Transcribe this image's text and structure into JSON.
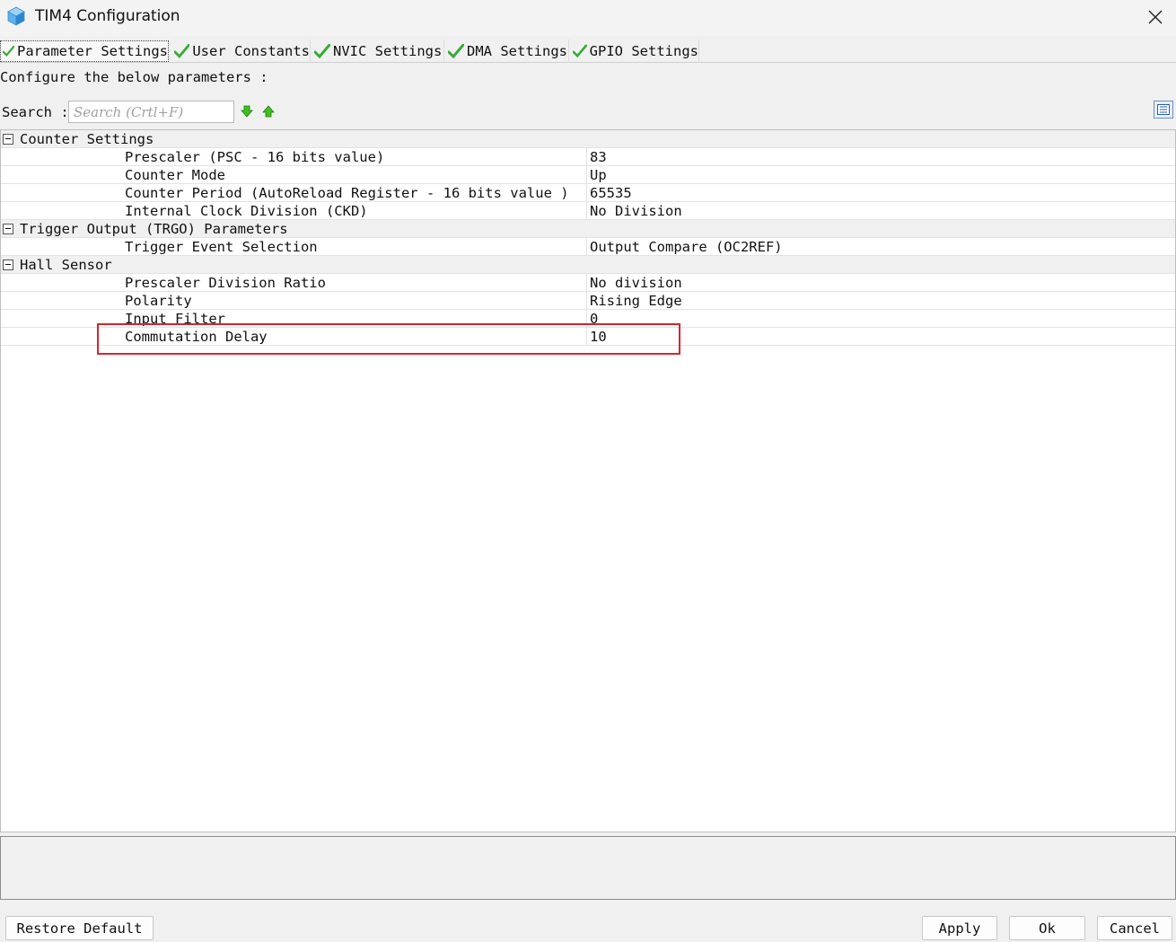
{
  "window": {
    "title": "TIM4 Configuration",
    "close_icon": "close-icon"
  },
  "tabs": [
    {
      "label": "Parameter Settings",
      "active": true
    },
    {
      "label": "User Constants",
      "active": false
    },
    {
      "label": "NVIC Settings",
      "active": false
    },
    {
      "label": "DMA Settings",
      "active": false
    },
    {
      "label": "GPIO Settings",
      "active": false
    }
  ],
  "intro_text": "Configure the below parameters :",
  "search": {
    "label": "Search :",
    "placeholder": "Search (Crtl+F)"
  },
  "groups": [
    {
      "label": "Counter Settings",
      "params": [
        {
          "name": "Prescaler (PSC - 16 bits value)",
          "value": "83"
        },
        {
          "name": "Counter Mode",
          "value": "Up"
        },
        {
          "name": "Counter Period (AutoReload Register - 16 bits value )",
          "value": "65535"
        },
        {
          "name": "Internal Clock Division (CKD)",
          "value": "No Division"
        }
      ]
    },
    {
      "label": "Trigger Output (TRGO) Parameters",
      "params": [
        {
          "name": "Trigger Event Selection",
          "value": "Output Compare (OC2REF)"
        }
      ]
    },
    {
      "label": "Hall Sensor",
      "params": [
        {
          "name": "Prescaler Division Ratio",
          "value": "No division"
        },
        {
          "name": "Polarity",
          "value": "Rising Edge"
        },
        {
          "name": "Input Filter",
          "value": "0"
        },
        {
          "name": "Commutation Delay",
          "value": "10"
        }
      ]
    }
  ],
  "buttons": {
    "restore_default": "Restore Default",
    "apply": "Apply",
    "ok": "Ok",
    "cancel": "Cancel"
  },
  "colors": {
    "check": "#3aa93a",
    "highlight": "#d6262e",
    "arrow": "#3fbf1f"
  }
}
